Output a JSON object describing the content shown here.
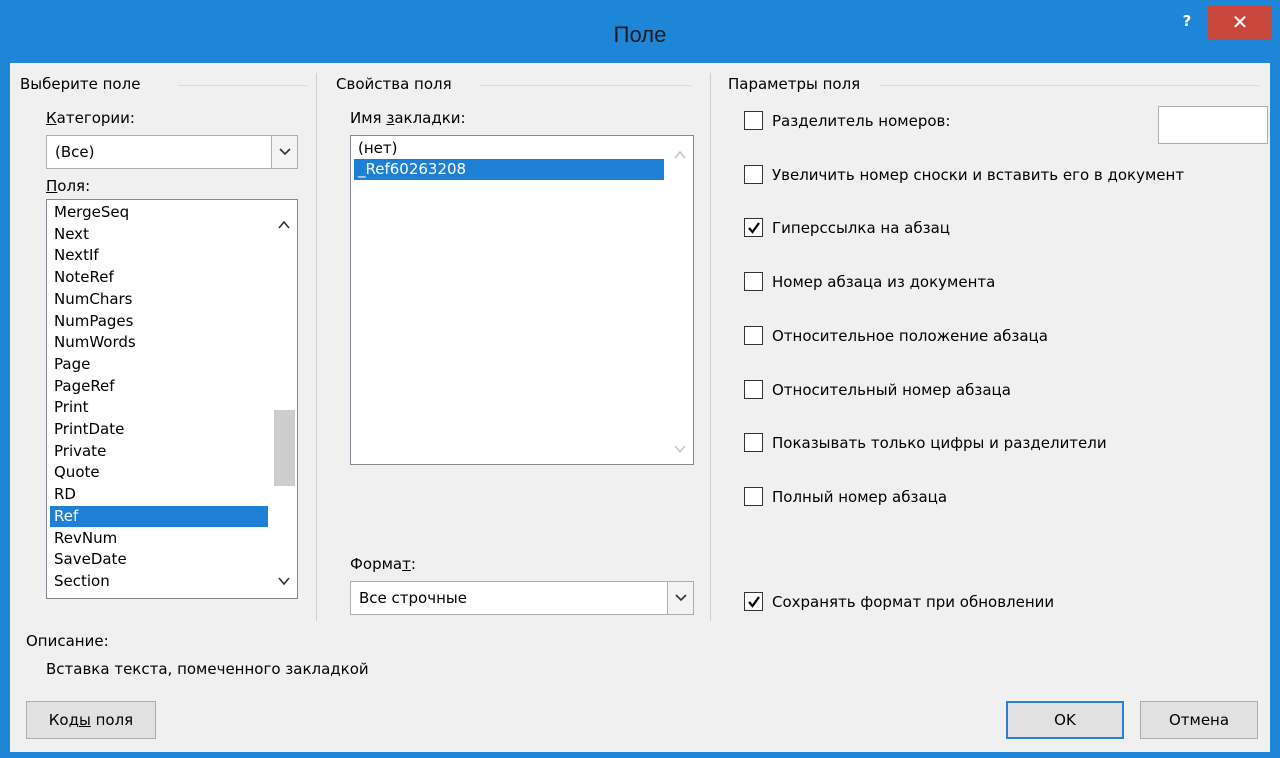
{
  "window": {
    "title": "Поле",
    "help": "?",
    "close": "✕"
  },
  "left": {
    "group_title": "Выберите поле",
    "categories_label": "Категории:",
    "categories_value": "(Все)",
    "fields_label": "Поля:",
    "fields": [
      "MergeSeq",
      "Next",
      "NextIf",
      "NoteRef",
      "NumChars",
      "NumPages",
      "NumWords",
      "Page",
      "PageRef",
      "Print",
      "PrintDate",
      "Private",
      "Quote",
      "RD",
      "Ref",
      "RevNum",
      "SaveDate",
      "Section"
    ],
    "selected_field": "Ref"
  },
  "middle": {
    "group_title": "Свойства поля",
    "bookmark_label": "Имя закладки:",
    "bookmarks": [
      "(нет)",
      "_Ref60263208"
    ],
    "selected_bookmark": "_Ref60263208",
    "format_label": "Формат:",
    "format_value": "Все строчные"
  },
  "right": {
    "group_title": "Параметры поля",
    "options": [
      {
        "label": "Разделитель номеров:",
        "checked": false
      },
      {
        "label": "Увеличить номер сноски и вставить его в документ",
        "checked": false
      },
      {
        "label": "Гиперссылка на абзац",
        "checked": true
      },
      {
        "label": "Номер абзаца из документа",
        "checked": false
      },
      {
        "label": "Относительное положение абзаца",
        "checked": false
      },
      {
        "label": "Относительный номер абзаца",
        "checked": false
      },
      {
        "label": "Показывать только цифры и разделители",
        "checked": false
      },
      {
        "label": "Полный номер абзаца",
        "checked": false
      }
    ],
    "preserve_format": {
      "label": "Сохранять формат при обновлении",
      "checked": true
    },
    "separator_value": ""
  },
  "description": {
    "label": "Описание:",
    "text": "Вставка текста, помеченного закладкой"
  },
  "buttons": {
    "field_codes": "Коды поля",
    "ok": "OK",
    "cancel": "Отмена"
  },
  "colors": {
    "titlebar": "#1e86d6",
    "close": "#c9463d",
    "selection": "#1e7fd6"
  }
}
